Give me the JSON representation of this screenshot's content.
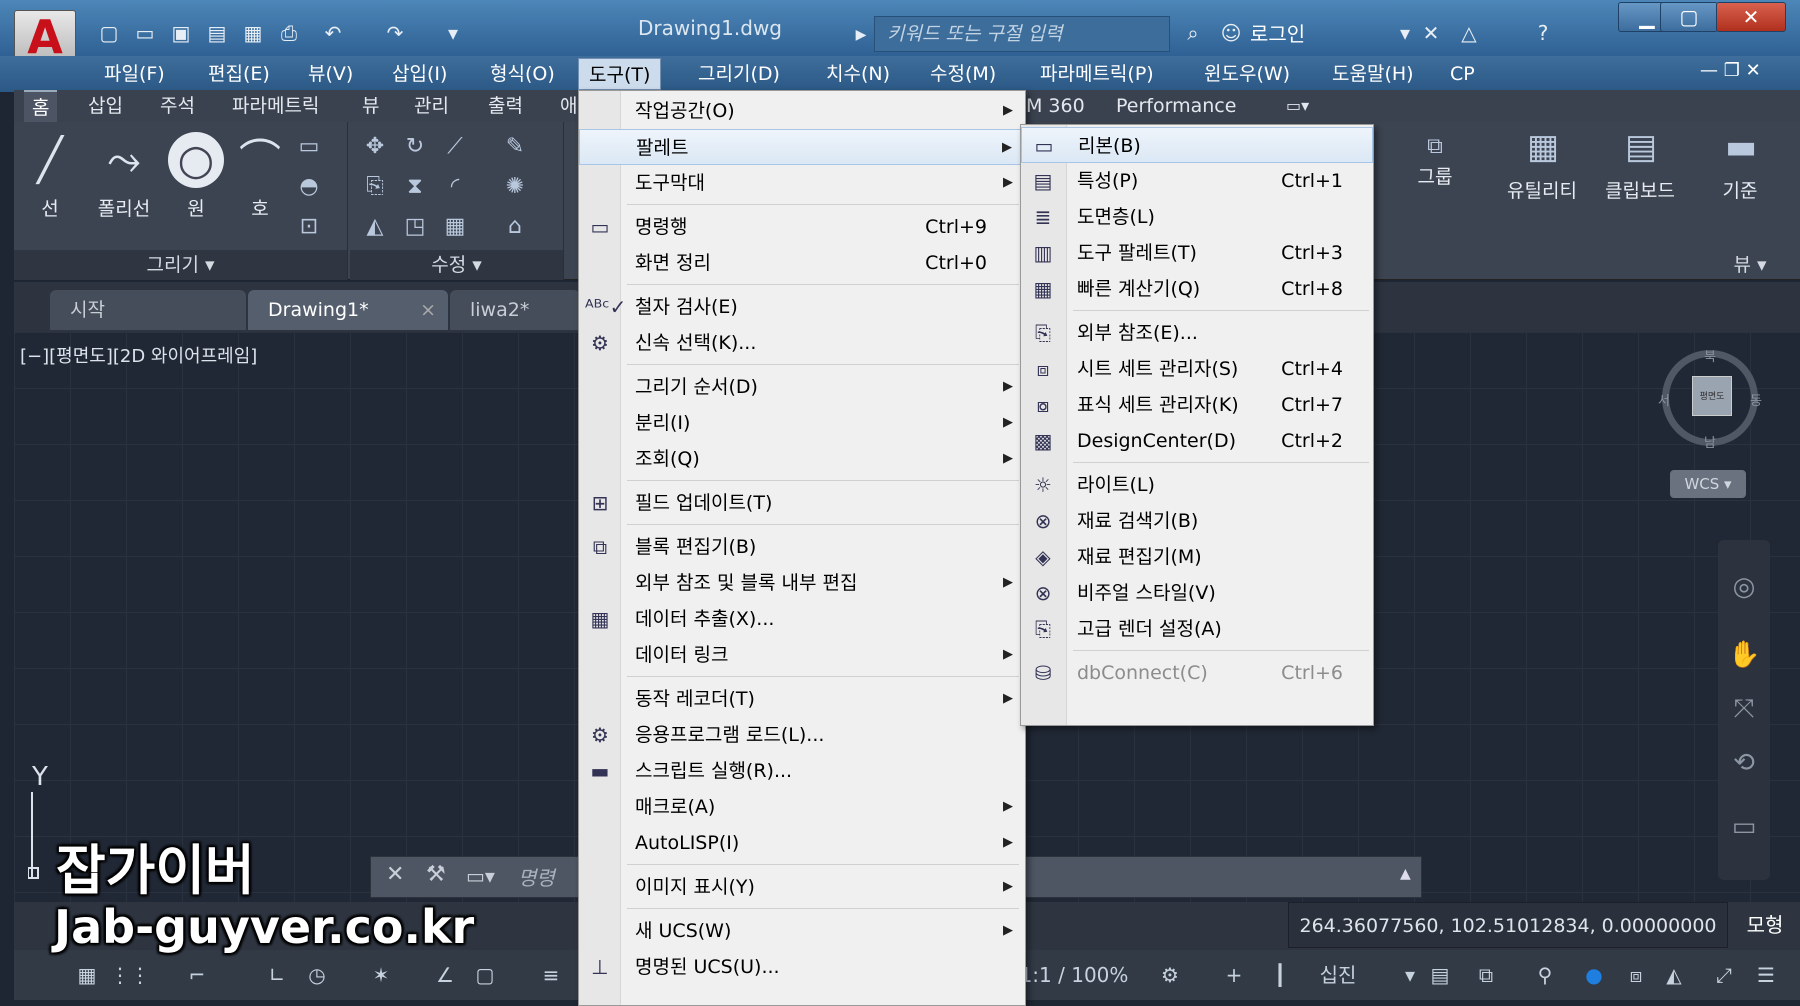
{
  "titlebar": {
    "document_title": "Drawing1.dwg",
    "search_placeholder": "키워드 또는 구절 입력",
    "login_label": "로그인",
    "app_logo": "A"
  },
  "menubar": [
    {
      "label": "파일(F)"
    },
    {
      "label": "편집(E)"
    },
    {
      "label": "뷰(V)"
    },
    {
      "label": "삽입(I)"
    },
    {
      "label": "형식(O)"
    },
    {
      "label": "도구(T)",
      "active": true
    },
    {
      "label": "그리기(D)"
    },
    {
      "label": "치수(N)"
    },
    {
      "label": "수정(M)"
    },
    {
      "label": "파라메트릭(P)"
    },
    {
      "label": "윈도우(W)"
    },
    {
      "label": "도움말(H)"
    },
    {
      "label": "CP"
    }
  ],
  "ribbon_tabs": [
    {
      "label": "홈",
      "active": true
    },
    {
      "label": "삽입"
    },
    {
      "label": "주석"
    },
    {
      "label": "파라메트릭"
    },
    {
      "label": "뷰"
    },
    {
      "label": "관리"
    },
    {
      "label": "출력"
    },
    {
      "label": "애"
    },
    {
      "label": "M 360"
    },
    {
      "label": "Performance"
    }
  ],
  "ribbon": {
    "draw_panel_label": "그리기 ▾",
    "modify_panel_label": "수정 ▾",
    "view_panel_label": "뷰 ▾",
    "draw_tools": [
      "선",
      "폴리선",
      "원",
      "호"
    ],
    "right_tools": [
      "그룹",
      "유틸리티",
      "클립보드",
      "기준"
    ]
  },
  "file_tabs": [
    {
      "label": "시작"
    },
    {
      "label": "Drawing1*",
      "active": true,
      "closable": "×"
    },
    {
      "label": "liwa2*"
    }
  ],
  "viewport": {
    "view_label": "[−][평면도][2D 와이어프레임]",
    "cube_label": "평면도",
    "dir_n": "북",
    "dir_s": "남",
    "dir_w": "서",
    "dir_e": "동",
    "wcs_label": "WCS ▾",
    "ucs_axis": "Y"
  },
  "command": {
    "placeholder": "명령"
  },
  "status": {
    "coordinates": "264.36077560, 102.51012834, 0.00000000",
    "model_label": "모형",
    "scale_label": "1:1 / 100% ▾",
    "crosshair_label": "십진"
  },
  "tools_menu": [
    {
      "label": "작업공간(O)",
      "arrow": "▶"
    },
    {
      "label": "팔레트",
      "arrow": "▶",
      "highlight": true
    },
    {
      "label": "도구막대",
      "arrow": "▶"
    },
    {
      "label": "명령행",
      "shortcut": "Ctrl+9",
      "icon": "▭"
    },
    {
      "label": "화면 정리",
      "shortcut": "Ctrl+0"
    },
    {
      "label": "철자 검사(E)",
      "icon": "ᴬᴮᶜ✓"
    },
    {
      "label": "신속 선택(K)...",
      "icon": "⚙"
    },
    {
      "label": "그리기 순서(D)",
      "arrow": "▶"
    },
    {
      "label": "분리(I)",
      "arrow": "▶"
    },
    {
      "label": "조회(Q)",
      "arrow": "▶"
    },
    {
      "label": "필드 업데이트(T)",
      "icon": "⊞"
    },
    {
      "label": "블록 편집기(B)",
      "icon": "⧉"
    },
    {
      "label": "외부 참조 및 블록 내부 편집",
      "arrow": "▶"
    },
    {
      "label": "데이터 추출(X)...",
      "icon": "▦"
    },
    {
      "label": "데이터 링크",
      "arrow": "▶"
    },
    {
      "label": "동작 레코더(T)",
      "arrow": "▶"
    },
    {
      "label": "응용프로그램 로드(L)...",
      "icon": "⚙"
    },
    {
      "label": "스크립트 실행(R)...",
      "icon": "▬"
    },
    {
      "label": "매크로(A)",
      "arrow": "▶"
    },
    {
      "label": "AutoLISP(I)",
      "arrow": "▶"
    },
    {
      "label": "이미지 표시(Y)",
      "arrow": "▶"
    },
    {
      "label": "새 UCS(W)",
      "arrow": "▶"
    },
    {
      "label": "명명된 UCS(U)...",
      "icon": "⊥"
    }
  ],
  "palettes_submenu": [
    {
      "label": "리본(B)",
      "highlight": true,
      "icon": "▭"
    },
    {
      "label": "특성(P)",
      "shortcut": "Ctrl+1",
      "icon": "▤"
    },
    {
      "label": "도면층(L)",
      "icon": "≣"
    },
    {
      "label": "도구 팔레트(T)",
      "shortcut": "Ctrl+3",
      "icon": "▥"
    },
    {
      "label": "빠른 계산기(Q)",
      "shortcut": "Ctrl+8",
      "icon": "▦"
    },
    {
      "label": "외부 참조(E)...",
      "icon": "⎘"
    },
    {
      "label": "시트 세트 관리자(S)",
      "shortcut": "Ctrl+4",
      "icon": "⧈"
    },
    {
      "label": "표식 세트 관리자(K)",
      "shortcut": "Ctrl+7",
      "icon": "⧇"
    },
    {
      "label": "DesignCenter(D)",
      "shortcut": "Ctrl+2",
      "icon": "▩"
    },
    {
      "label": "라이트(L)",
      "icon": "☼"
    },
    {
      "label": "재료 검색기(B)",
      "icon": "⊗"
    },
    {
      "label": "재료 편집기(M)",
      "icon": "◈"
    },
    {
      "label": "비주얼 스타일(V)",
      "icon": "⊗"
    },
    {
      "label": "고급 렌더 설정(A)",
      "icon": "⎘"
    },
    {
      "label": "dbConnect(C)",
      "shortcut": "Ctrl+6",
      "disabled": true,
      "icon": "⛁"
    }
  ],
  "watermark": {
    "line1": "잡가이버",
    "line2": "Jab-guyver.co.kr"
  }
}
